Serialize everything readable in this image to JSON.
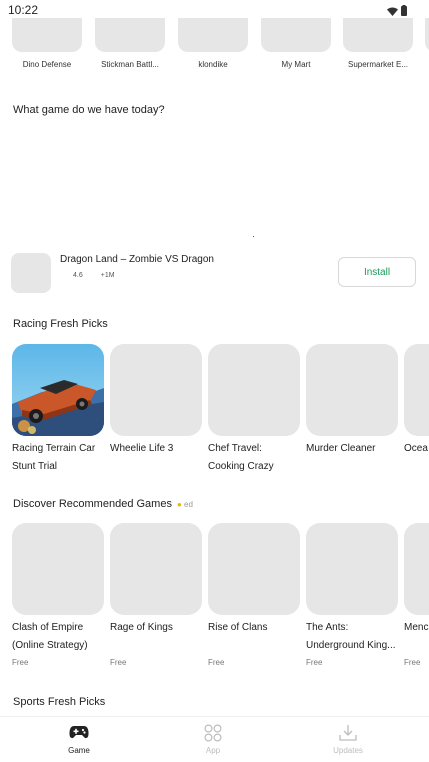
{
  "status_bar": {
    "time": "10:22",
    "icons": [
      "wifi-icon",
      "battery-icon"
    ]
  },
  "top_row": [
    {
      "label": "Dino Defense"
    },
    {
      "label": "Stickman Battl..."
    },
    {
      "label": "klondike"
    },
    {
      "label": "My Mart"
    },
    {
      "label": "Supermarket E..."
    }
  ],
  "question": "What game do we have today?",
  "featured": {
    "title": "Dragon Land – Zombie VS Dragon",
    "rating": "4.6",
    "downloads": "+1M",
    "install_label": "Install"
  },
  "racing": {
    "title": "Racing Fresh Picks",
    "cards": [
      {
        "name": "Racing Terrain Car Stunt Trial"
      },
      {
        "name": "Wheelie Life 3"
      },
      {
        "name": "Chef Travel: Cooking Crazy"
      },
      {
        "name": "Murder Cleaner"
      },
      {
        "name": "Ocea Stum"
      }
    ]
  },
  "discover": {
    "title": "Discover Recommended Games",
    "tag": "ed",
    "cards": [
      {
        "name": "Clash of Empire (Online Strategy)",
        "price": "Free"
      },
      {
        "name": "Rage of Kings",
        "price": "Free"
      },
      {
        "name": "Rise of Clans",
        "price": "Free"
      },
      {
        "name": "The Ants: Underground King...",
        "price": "Free"
      },
      {
        "name": "Menc mens",
        "price": "Free"
      }
    ]
  },
  "sports": {
    "title": "Sports Fresh Picks"
  },
  "bottom_nav": [
    {
      "label": "Game",
      "active": true
    },
    {
      "label": "App",
      "active": false
    },
    {
      "label": "Updates",
      "active": false
    }
  ],
  "colors": {
    "accent": "#1a9a5c",
    "placeholder": "#e6e6e6",
    "active_nav": "#222222",
    "inactive_nav": "#bdbdbd"
  }
}
